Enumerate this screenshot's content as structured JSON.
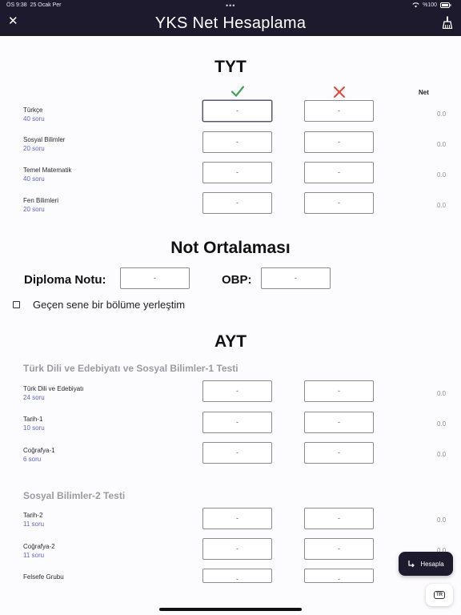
{
  "status_bar": {
    "time": "ÖS 9:38",
    "date": "25 Ocak Per",
    "battery": "%100"
  },
  "header": {
    "title": "YKS Net Hesaplama"
  },
  "tyt": {
    "title": "TYT",
    "net_header": "Net",
    "rows": [
      {
        "label": "Türkçe",
        "sub": "40 soru",
        "correct": "-",
        "wrong": "-",
        "net": "0.0"
      },
      {
        "label": "Sosyal Bilimler",
        "sub": "20 soru",
        "correct": "-",
        "wrong": "-",
        "net": "0.0"
      },
      {
        "label": "Temel Matematik",
        "sub": "40 soru",
        "correct": "-",
        "wrong": "-",
        "net": "0.0"
      },
      {
        "label": "Fen Bilimleri",
        "sub": "20 soru",
        "correct": "-",
        "wrong": "-",
        "net": "0.0"
      }
    ]
  },
  "not_ortalamasi": {
    "title": "Not Ortalaması",
    "diploma_label": "Diploma Notu:",
    "diploma_value": "-",
    "obp_label": "OBP:",
    "obp_value": "-",
    "checkbox_label": "Geçen sene bir bölüme yerleştim",
    "checkbox_checked": false
  },
  "ayt": {
    "title": "AYT",
    "groups": [
      {
        "title": "Türk Dili ve Edebiyatı ve Sosyal Bilimler-1 Testi",
        "rows": [
          {
            "label": "Türk Dili ve Edebiyatı",
            "sub": "24 soru",
            "correct": "-",
            "wrong": "-",
            "net": "0.0"
          },
          {
            "label": "Tarih-1",
            "sub": "10 soru",
            "correct": "-",
            "wrong": "-",
            "net": "0.0"
          },
          {
            "label": "Coğrafya-1",
            "sub": "6 soru",
            "correct": "-",
            "wrong": "-",
            "net": "0.0"
          }
        ]
      },
      {
        "title": "Sosyal Bilimler-2 Testi",
        "rows": [
          {
            "label": "Tarih-2",
            "sub": "11 soru",
            "correct": "-",
            "wrong": "-",
            "net": "0.0"
          },
          {
            "label": "Coğrafya-2",
            "sub": "11 soru",
            "correct": "-",
            "wrong": "-",
            "net": "0.0"
          },
          {
            "label": "Felsefe Grubu",
            "sub": "",
            "correct": "-",
            "wrong": "-",
            "net": ""
          }
        ]
      }
    ]
  },
  "fab": {
    "label": "Hesapla"
  },
  "lang": {
    "label": "TR"
  },
  "icons": {
    "correct": "check-icon",
    "wrong": "cross-icon",
    "close": "close-icon",
    "clear": "broom-icon",
    "calculate": "turn-arrow-icon",
    "lang": "language-icon"
  },
  "colors": {
    "header_bg": "#1e1a2e",
    "correct": "#3aa655",
    "wrong": "#e0483c",
    "sub_text": "#5b67c9"
  }
}
